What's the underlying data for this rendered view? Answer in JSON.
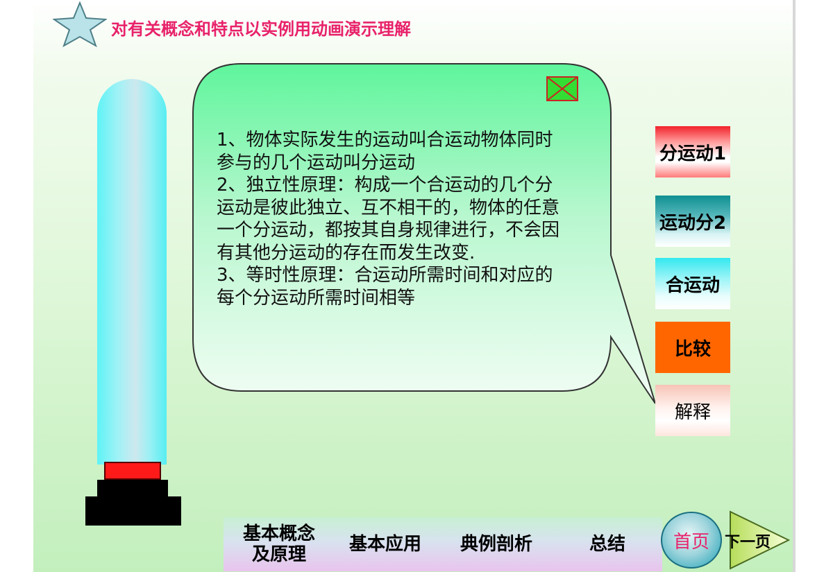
{
  "header": {
    "title": "对有关概念和特点以实例用动画演示理解"
  },
  "bubble": {
    "lines": [
      "1、物体实际发生的运动叫合运动物体同时\n参与的几个运动叫分运动",
      "2、独立性原理：构成一个合运动的几个分\n运动是彼此独立、互不相干的，物体的任意\n一个分运动，都按其自身规律进行，不会因\n有其他分运动的存在而发生改变.",
      "3、等时性原理：合运动所需时间和对应的\n每个分运动所需时间相等"
    ]
  },
  "side_buttons": {
    "b1": "分运动1",
    "b2": "运动分2",
    "b3": "合运动",
    "b4": "比较",
    "b5": "解释"
  },
  "nav": {
    "item1": "基本概念\n及原理",
    "item2": "基本应用",
    "item3": "典例剖析",
    "item4": "总结",
    "home": "首页",
    "next": "下一页"
  },
  "colors": {
    "title": "#e8226a",
    "bubble_fill": "#5ff59c",
    "compare_button": "#ff6600",
    "close_box": "#33dd33"
  },
  "icons": {
    "star": "star-icon",
    "close": "close-box-icon",
    "next": "triangle-next-icon"
  }
}
